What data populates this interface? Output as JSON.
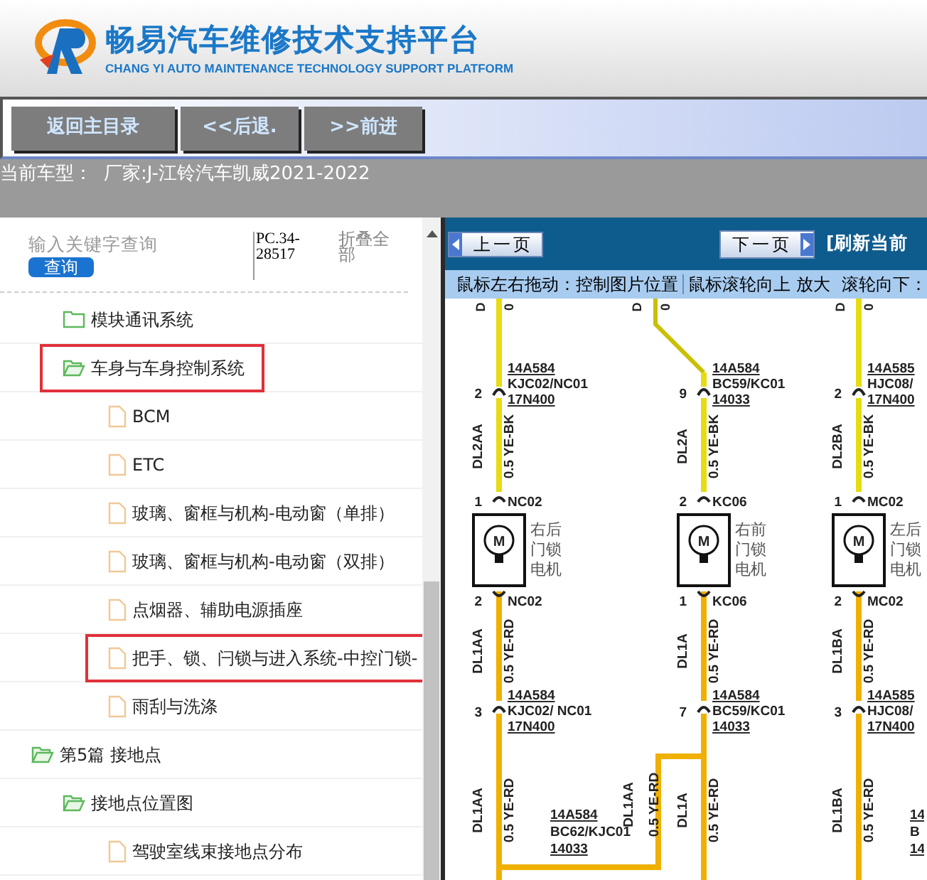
{
  "header": {
    "title": "畅易汽车维修技术支持平台",
    "subtitle": "CHANG YI AUTO MAINTENANCE TECHNOLOGY SUPPORT PLATFORM"
  },
  "nav_buttons": [
    "返回主目录",
    "<<后退.",
    ">>前进"
  ],
  "current_model": {
    "label": "当前车型：",
    "value": "厂家:J-江铃汽车凯威2021-2022"
  },
  "sidebar": {
    "search": {
      "placeholder": "输入关键字查询",
      "button": "查询"
    },
    "code": "PC.34-28517",
    "collapse_all": "折叠全部",
    "continued_items": [
      {
        "label": "模块通讯系统",
        "kind": "folder",
        "expanded": false,
        "highlighted": false
      },
      {
        "label": "车身与车身控制系统",
        "kind": "folder",
        "expanded": true,
        "highlighted": true,
        "children": [
          {
            "label": "BCM",
            "kind": "doc",
            "highlighted": false
          },
          {
            "label": "ETC",
            "kind": "doc",
            "highlighted": false
          },
          {
            "label": "玻璃、窗框与机构-电动窗（单排）",
            "kind": "doc",
            "highlighted": false
          },
          {
            "label": "玻璃、窗框与机构-电动窗（双排）",
            "kind": "doc",
            "highlighted": false
          },
          {
            "label": "点烟器、辅助电源插座",
            "kind": "doc",
            "highlighted": false
          },
          {
            "label": "把手、锁、闩锁与进入系统-中控门锁-",
            "kind": "doc",
            "highlighted": true
          },
          {
            "label": "雨刮与洗涤",
            "kind": "doc",
            "highlighted": false
          }
        ]
      }
    ],
    "items": [
      {
        "label": "第5篇 接地点",
        "kind": "folder",
        "expanded": true,
        "highlighted": false,
        "children": [
          {
            "label": "接地点位置图",
            "kind": "folder",
            "expanded": true,
            "highlighted": false,
            "children": [
              {
                "label": "驾驶室线束接地点分布",
                "kind": "doc",
                "highlighted": false
              }
            ]
          }
        ]
      }
    ]
  },
  "viewer": {
    "prev": "上一页",
    "next": "下一页",
    "refresh": "[刷新当前",
    "hints": [
      "鼠标左右拖动：控制图片位置",
      "鼠标滚轮向上 放大",
      "滚轮向下："
    ],
    "diagram": {
      "columns": [
        {
          "top_cut": [
            "D",
            "0"
          ],
          "conn1": {
            "pin": "2",
            "lines": [
              "14A584",
              "KJC02/NC01",
              "17N400"
            ]
          },
          "wire1": [
            "DL2AA",
            "0.5 YE-BK"
          ],
          "pin_a": {
            "pin": "1",
            "label": "NC02"
          },
          "component": [
            "右后",
            "门锁",
            "电机"
          ],
          "symbol": "M",
          "pin_b": {
            "pin": "2",
            "label": "NC02"
          },
          "wire2": [
            "DL1AA",
            "0.5 YE-RD"
          ],
          "conn2": {
            "pin": "3",
            "lines": [
              "14A584",
              "KJC02/ NC01",
              "17N400"
            ]
          },
          "wire3": [
            "DL1AA",
            "0.5 YE-RD"
          ],
          "splice": [
            "14A584",
            "BC62/KJC01",
            "14033"
          ]
        },
        {
          "top_cut": [
            "D",
            "0"
          ],
          "conn1": {
            "pin": "9",
            "lines": [
              "14A584",
              "BC59/KC01",
              "14033"
            ]
          },
          "wire1": [
            "DL2A",
            "0.5 YE-BK"
          ],
          "pin_a": {
            "pin": "2",
            "label": "KC06"
          },
          "component": [
            "右前",
            "门锁",
            "电机"
          ],
          "symbol": "M",
          "pin_b": {
            "pin": "1",
            "label": "KC06"
          },
          "wire2": [
            "DL1A",
            "0.5 YE-RD"
          ],
          "conn2": {
            "pin": "7",
            "lines": [
              "14A584",
              "BC59/KC01",
              "14033"
            ]
          },
          "wire3": [
            "DL1A",
            "0.5 YE-RD"
          ],
          "join_wire": [
            "DL1AA",
            "0.5 YE-RD"
          ]
        },
        {
          "top_cut": [
            "D",
            "0"
          ],
          "conn1": {
            "pin": "2",
            "lines": [
              "14A585",
              "HJC08/",
              "17N400"
            ]
          },
          "wire1": [
            "DL2BA",
            "0.5 YE-BK"
          ],
          "pin_a": {
            "pin": "1",
            "label": "MC02"
          },
          "component": [
            "左后",
            "门锁",
            "电机"
          ],
          "symbol": "M",
          "pin_b": {
            "pin": "2",
            "label": "MC02"
          },
          "wire2": [
            "DL1BA",
            "0.5 YE-RD"
          ],
          "conn2": {
            "pin": "3",
            "lines": [
              "14A585",
              "HJC08/",
              "17N400"
            ]
          },
          "wire3": [
            "DL1BA",
            "0.5 YE-RD"
          ],
          "splice": [
            "14",
            "B",
            "14"
          ]
        }
      ]
    }
  }
}
